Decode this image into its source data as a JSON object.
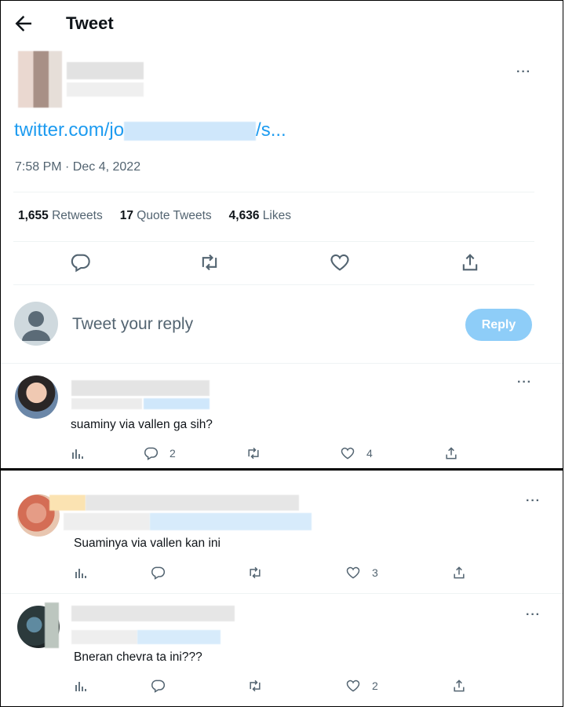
{
  "header": {
    "title": "Tweet",
    "back_icon": "arrow-left-icon"
  },
  "tweet": {
    "link_text": "twitter.com/jo",
    "link_suffix": "/s...",
    "timestamp": "7:58 PM · Dec 4, 2022",
    "stats": [
      {
        "count": "1,655",
        "label": "Retweets"
      },
      {
        "count": "17",
        "label": "Quote Tweets"
      },
      {
        "count": "4,636",
        "label": "Likes"
      }
    ],
    "more_label": "···"
  },
  "reply_box": {
    "placeholder": "Tweet your reply",
    "button_label": "Reply"
  },
  "replies": [
    {
      "text": "suaminy via vallen ga sih?",
      "reply_count": "2",
      "like_count": "4",
      "more_label": "···"
    },
    {
      "text": "Suaminya via vallen kan ini",
      "reply_count": "",
      "like_count": "3",
      "more_label": "···"
    },
    {
      "text": "Bneran chevra ta ini???",
      "reply_count": "",
      "like_count": "2",
      "more_label": "···"
    }
  ],
  "colors": {
    "accent": "#1d9bf0",
    "reply_button_disabled": "#8ecdf8",
    "muted": "#536471"
  }
}
